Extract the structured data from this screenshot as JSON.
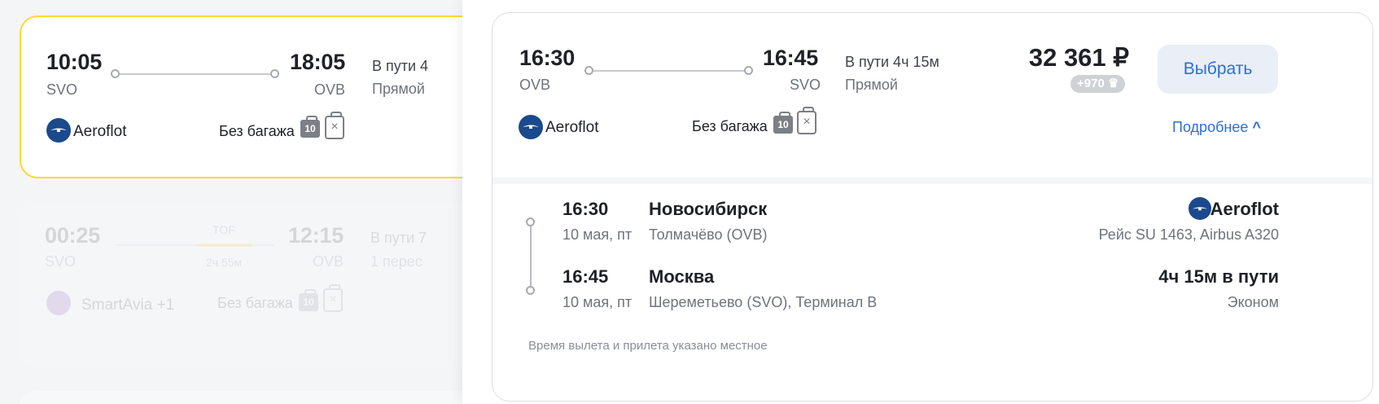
{
  "results": [
    {
      "dep_time": "10:05",
      "dep_code": "SVO",
      "arr_time": "18:05",
      "arr_code": "OVB",
      "duration": "В пути 4",
      "stops": "Прямой",
      "airline": "Aeroflot",
      "baggage": "Без багажа",
      "hand_luggage": "10"
    },
    {
      "dep_time": "00:25",
      "dep_code": "SVO",
      "arr_time": "12:15",
      "arr_code": "OVB",
      "stop_code": "TOF",
      "stop_duration": "2ч 55м",
      "duration": "В пути 7",
      "stops": "1 перес",
      "airline": "SmartAvia +1",
      "baggage": "Без багажа",
      "hand_luggage": "10"
    }
  ],
  "detail": {
    "dep_time": "16:30",
    "dep_code": "OVB",
    "arr_time": "16:45",
    "arr_code": "SVO",
    "duration": "В пути 4ч 15м",
    "stops": "Прямой",
    "price": "32 361 ₽",
    "bonus": "+970",
    "select_label": "Выбрать",
    "airline": "Aeroflot",
    "baggage": "Без багажа",
    "hand_luggage": "10",
    "more_label": "Подробнее",
    "segment": {
      "dep_time": "16:30",
      "dep_date": "10 мая, пт",
      "dep_city": "Новосибирск",
      "dep_airport": "Толмачёво (OVB)",
      "arr_time": "16:45",
      "arr_date": "10 мая, пт",
      "arr_city": "Москва",
      "arr_airport": "Шереметьево (SVO), Терминал B",
      "airline": "Aeroflot",
      "flight_info": "Рейс SU 1463, Airbus A320",
      "duration": "4ч 15м в пути",
      "cabin": "Эконом"
    },
    "note": "Время вылета и прилета указано местное"
  },
  "colors": {
    "accent": "#2b6fd8",
    "highlight_border": "#ffd930",
    "aeroflot": "#1a4a8c"
  }
}
